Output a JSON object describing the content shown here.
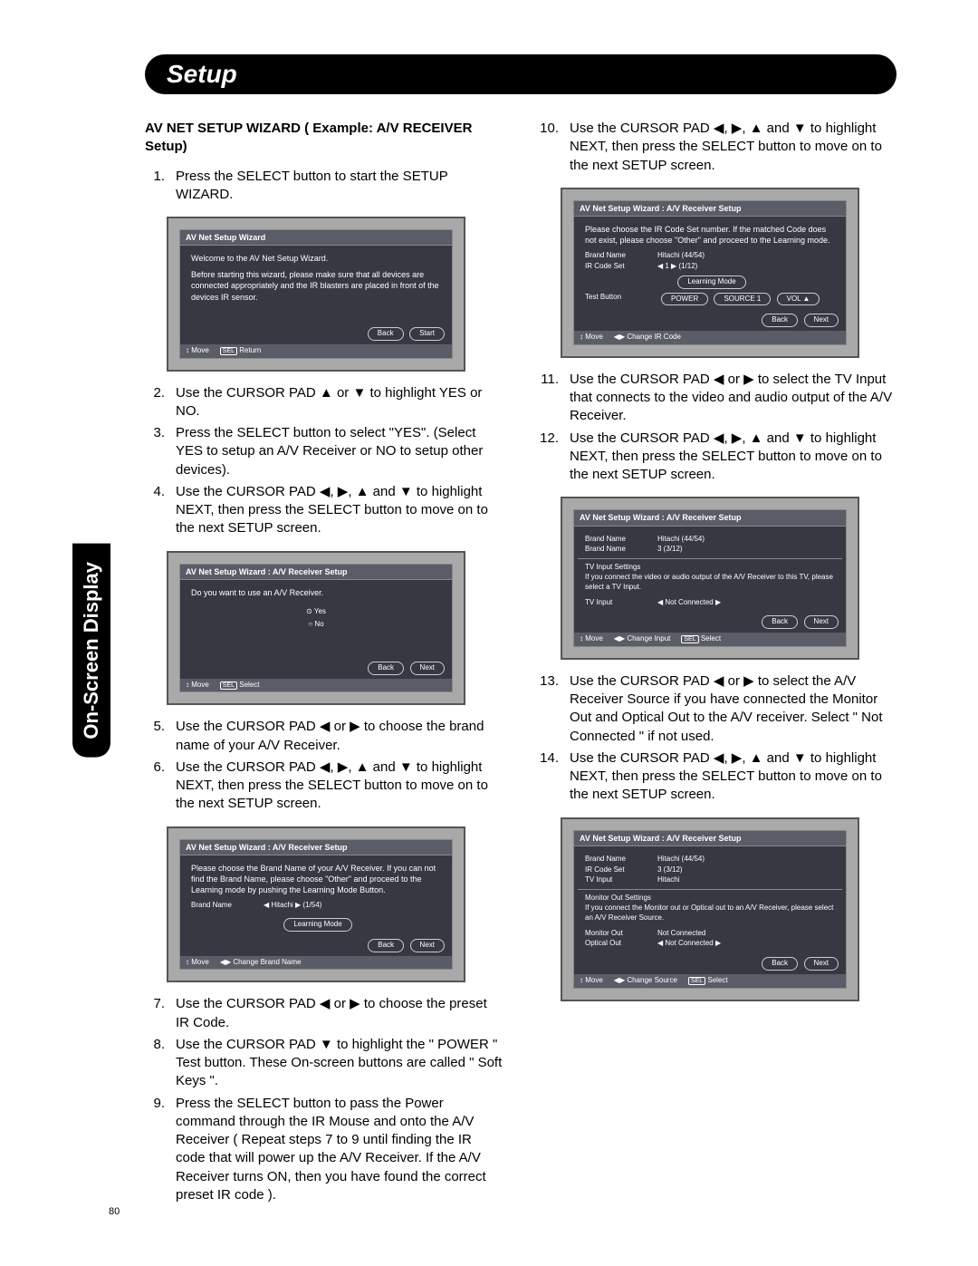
{
  "page_number": "80",
  "header": "Setup",
  "side_tab": "On-Screen Display",
  "subheading": "AV NET SETUP WIZARD ( Example: A/V RECEIVER Setup)",
  "steps_left": {
    "s1": {
      "n": "1.",
      "t": "Press the SELECT button to start the SETUP WIZARD."
    },
    "s2": {
      "n": "2.",
      "t": "Use the CURSOR PAD ▲ or ▼ to highlight YES or NO."
    },
    "s3": {
      "n": "3.",
      "t": "Press the SELECT button to select \"YES\". (Select YES to setup an A/V Receiver or NO to setup other devices)."
    },
    "s4": {
      "n": "4.",
      "t": "Use the CURSOR PAD ◀, ▶, ▲ and ▼ to highlight NEXT, then press the SELECT button to move on to the next SETUP screen."
    },
    "s5": {
      "n": "5.",
      "t": "Use the CURSOR PAD ◀ or ▶ to choose the brand name of your A/V Receiver."
    },
    "s6": {
      "n": "6.",
      "t": "Use the CURSOR PAD ◀, ▶, ▲ and ▼ to highlight NEXT, then press the SELECT button to move on to the next SETUP screen."
    },
    "s7": {
      "n": "7.",
      "t": "Use the CURSOR PAD ◀ or ▶ to choose the preset IR Code."
    },
    "s8": {
      "n": "8.",
      "t": "Use the CURSOR PAD ▼ to highlight the \" POWER \" Test button. These On-screen buttons are called \" Soft Keys \"."
    },
    "s9": {
      "n": "9.",
      "t": "Press the SELECT button to pass the Power command through the IR Mouse and onto the A/V Receiver ( Repeat steps 7 to 9 until finding the IR code that will power up the A/V Receiver. If the A/V Receiver turns ON, then you have found the correct preset IR code )."
    }
  },
  "steps_right": {
    "s10": {
      "n": "10.",
      "t": "Use the CURSOR PAD ◀, ▶, ▲ and ▼ to highlight NEXT, then press the SELECT button to move on to the next SETUP screen."
    },
    "s11": {
      "n": "11.",
      "t": "Use the CURSOR PAD ◀ or ▶ to select the TV Input that connects  to the video and audio output of the A/V Receiver."
    },
    "s12": {
      "n": "12.",
      "t": "Use the CURSOR PAD ◀, ▶, ▲ and ▼ to highlight NEXT, then press the SELECT button to move on to the next SETUP screen."
    },
    "s13": {
      "n": "13.",
      "t": "Use the CURSOR PAD ◀ or ▶ to select the A/V Receiver Source if you have connected the Monitor Out and Optical Out to the A/V receiver. Select \" Not Connected \" if not used."
    },
    "s14": {
      "n": "14.",
      "t": "Use the CURSOR PAD ◀, ▶, ▲ and ▼ to highlight NEXT, then press the SELECT button to move on to the next SETUP screen."
    }
  },
  "screens": {
    "A": {
      "title": "AV Net Setup Wizard",
      "welcome": "Welcome to the AV Net Setup Wizard.",
      "body": "Before starting this wizard, please make sure that all devices are connected appropriately and the IR blasters are placed in front of the devices IR sensor.",
      "btn_back": "Back",
      "btn_start": "Start",
      "foot_move": "Move",
      "foot_sel": "SEL",
      "foot_return": "Return"
    },
    "B": {
      "title": "AV Net Setup Wizard : A/V Receiver Setup",
      "question": "Do you want to use an A/V Receiver.",
      "opt_yes": "Yes",
      "opt_no": "No",
      "btn_back": "Back",
      "btn_next": "Next",
      "foot_move": "Move",
      "foot_sel": "SEL",
      "foot_select": "Select"
    },
    "C": {
      "title": "AV Net Setup Wizard : A/V Receiver Setup",
      "body": "Please choose the Brand Name of your A/V Receiver. If you can not find the Brand Name, please choose \"Other\" and proceed to the Learning mode by pushing the Learning Mode Button.",
      "brand_k": "Brand Name",
      "brand_v": "◀  Hitachi  ▶    (1/54)",
      "learn": "Learning Mode",
      "btn_back": "Back",
      "btn_next": "Next",
      "foot_move": "Move",
      "foot_change": "Change Brand Name"
    },
    "D": {
      "title": "AV Net Setup Wizard : A/V Receiver Setup",
      "body": "Please choose the IR Code Set number. If the matched Code does not exist, please choose \"Other\" and proceed to the Learning mode.",
      "brand_k": "Brand Name",
      "brand_v": "Hitachi         (44/54)",
      "ir_k": "IR Code Set",
      "ir_v": "◀  1  ▶    (1/12)",
      "learn": "Learning Mode",
      "test_k": "Test Button",
      "test_power": "POWER",
      "test_source": "SOURCE 1",
      "test_vol": "VOL ▲",
      "btn_back": "Back",
      "btn_next": "Next",
      "foot_move": "Move",
      "foot_change": "Change IR Code"
    },
    "E": {
      "title": "AV Net Setup Wizard : A/V Receiver Setup",
      "brand_k": "Brand Name",
      "brand_v": "Hitachi         (44/54)",
      "brand2_k": "Brand Name",
      "brand2_v": "3          (3/12)",
      "sect": "TV Input Settings",
      "body": "If you connect the video or audio output of the A/V Receiver to this TV, please select a TV Input.",
      "tv_k": "TV Input",
      "tv_v": "◀  Not Connected  ▶",
      "btn_back": "Back",
      "btn_next": "Next",
      "foot_move": "Move",
      "foot_change": "Change Input",
      "foot_sel": "SEL",
      "foot_select": "Select"
    },
    "F": {
      "title": "AV Net Setup Wizard : A/V Receiver Setup",
      "brand_k": "Brand Name",
      "brand_v": "Hitachi         (44/54)",
      "ir_k": "IR Code Set",
      "ir_v": "3          (3/12)",
      "tv_k": "TV Input",
      "tv_v": "Hitachi",
      "sect": "Monitor Out Settings",
      "body": "If you connect the Monitor out or Optical out to an A/V Receiver, please select an A/V Receiver Source.",
      "mon_k": "Monitor Out",
      "mon_v": "Not Connected",
      "opt_k": "Optical Out",
      "opt_v": "◀  Not Connected  ▶",
      "btn_back": "Back",
      "btn_next": "Next",
      "foot_move": "Move",
      "foot_change": "Change Source",
      "foot_sel": "SEL",
      "foot_select": "Select"
    }
  }
}
